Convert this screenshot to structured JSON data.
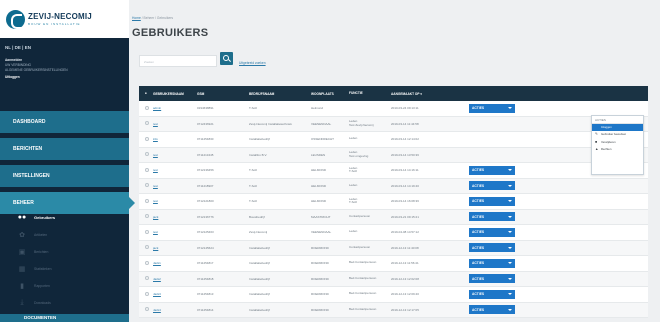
{
  "sidebar": {
    "logo_main": "ZEVIJ-NECOMIJ",
    "logo_sub": "BOUW EN INSTALLATIE",
    "lang": "NL | DE | EN",
    "user": {
      "title": "Aanmelden",
      "line1": "UW VERBINDING",
      "line2": "ALGEMENE GEBRUIKERSINSTELLINGEN",
      "logout": "Uitloggen"
    },
    "nav": [
      {
        "label": "DASHBOARD"
      },
      {
        "label": "BERICHTEN"
      },
      {
        "label": "INSTELLINGEN"
      },
      {
        "label": "BEHEER"
      }
    ],
    "subnav": [
      {
        "label": "Gebruikers",
        "icon": "users-icon"
      },
      {
        "label": "Artikelen",
        "icon": "puzzle-icon"
      },
      {
        "label": "Berichten",
        "icon": "document-icon"
      },
      {
        "label": "Statistieken",
        "icon": "stats-icon"
      },
      {
        "label": "Rapporten",
        "icon": "chart-icon"
      },
      {
        "label": "Downloads",
        "icon": "download-icon"
      }
    ],
    "bottom_nav": "DOCUMENTEN"
  },
  "main": {
    "breadcrumb": {
      "home": "Home",
      "rest": " / Beheer / Gebruikers"
    },
    "title": "GEBRUIKERS",
    "search_placeholder": "Zoeken",
    "advanced_link": "Uitgebreid zoeken"
  },
  "table": {
    "headers": {
      "user": "GEBRUIKERSNAAM",
      "id": "GSM",
      "name": "BEDRIJFSNAAM",
      "place": "WOONPLAATS",
      "company": "FUNCTIE",
      "date": "AANGEMAAKT OP"
    },
    "action_label": "ACTIES",
    "rows": [
      {
        "user": "admin",
        "id": "0194638891",
        "name": "T-Soft",
        "place": "Helmond",
        "company": "",
        "date": "2010-03-24 09:13:11"
      },
      {
        "user": "test",
        "id": "0712436921",
        "name": "Zevij-Necomij Installatietechniek",
        "place": "VEENENDAAL",
        "company": "Leden\nTest Zevij-Necomij",
        "date": "2019-03-14 11:44:58"
      },
      {
        "user": "info",
        "id": "0711254830",
        "name": "Installatiebedrijf",
        "place": "OSSENDRECHT",
        "company": "Leden",
        "date": "2019-03-14 12:14:02"
      },
      {
        "user": "test",
        "id": "0711213445",
        "name": "Installfox B.V.",
        "place": "LEUSDEN",
        "company": "Leden\nTest omgeving",
        "date": "2019-03-14 13:50:36"
      },
      {
        "user": "test",
        "id": "0712136456",
        "name": "T-Soft",
        "place": "HELMOND",
        "company": "Leden\nT-Soft",
        "date": "2019-03-14 14:16:11"
      },
      {
        "user": "test",
        "id": "0711218907",
        "name": "T-Soft",
        "place": "HELMOND",
        "company": "Leden",
        "date": "2019-03-14 14:19:40"
      },
      {
        "user": "test",
        "id": "0712121800",
        "name": "T-Soft",
        "place": "HELMOND",
        "company": "Leden\nT-Soft",
        "date": "2019-03-14 16:08:36"
      },
      {
        "user": "jack",
        "id": "0712136776",
        "name": "Bouwbedrijf",
        "place": "MAASTRICHT",
        "company": "Contactpersoon",
        "date": "2019-03-21 09:15:21"
      },
      {
        "user": "test",
        "id": "0712125463",
        "name": "Zevij-Necomij",
        "place": "VEENENDAAL",
        "company": "Leden",
        "date": "2019-04-08 14:57:12"
      },
      {
        "user": "jack",
        "id": "0712145624",
        "name": "Installatiebedrijf",
        "place": "ROERMOND",
        "company": "Contactpersoon",
        "date": "2019-12-13 11:40:08"
      },
      {
        "user": "Jack1",
        "id": "0711254817",
        "name": "Installatiebedrijf",
        "place": "ROERMOND",
        "company": "Bed.Contactpersoon",
        "date": "2019-12-13 11:56:41"
      },
      {
        "user": "Jack2",
        "id": "0711254818",
        "name": "Installatiebedrijf",
        "place": "ROERMOND",
        "company": "Bed.Contactpersoon",
        "date": "2019-12-13 12:02:08"
      },
      {
        "user": "Jack3",
        "id": "0711254813",
        "name": "Installatiebedrijf",
        "place": "ROERMOND",
        "company": "Bed.Contactpersoon",
        "date": "2019-12-13 12:09:40"
      },
      {
        "user": "Jack4",
        "id": "0711254814",
        "name": "Installatiebedrijf",
        "place": "ROERMOND",
        "company": "Bed.Contactpersoon",
        "date": "2019-12-13 12:17:05"
      }
    ]
  },
  "dropdown": {
    "header": "ACTIES",
    "items": [
      {
        "label": "Inloggen",
        "icon": "login-icon"
      },
      {
        "label": "Gebruiker bewerken",
        "icon": "edit-icon"
      },
      {
        "label": "Verwijderen",
        "icon": "delete-icon"
      },
      {
        "label": "Rechten",
        "icon": "rights-icon"
      }
    ]
  },
  "colors": {
    "accent": "#1e6e8c",
    "primary_button": "#1e77c8",
    "sidebar": "#10263a",
    "table_header": "#1a3344"
  }
}
